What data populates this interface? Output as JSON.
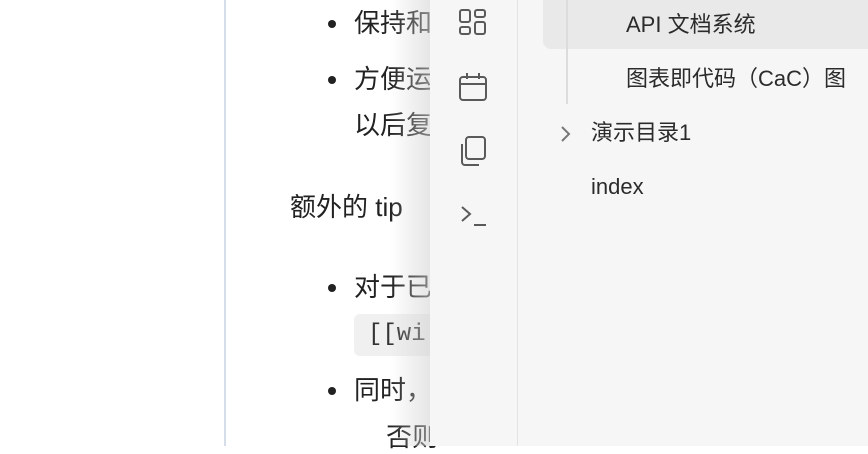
{
  "editor": {
    "bullet1": "保持和",
    "bullet2_line1": "方便运",
    "bullet2_line2": "以后复",
    "extra_tip": "额外的 tip",
    "bullet3": "对于已",
    "code_text": "[[wi",
    "bullet4": "同时，",
    "bullet4_line2": "否则"
  },
  "ribbon": {
    "icons": [
      "grid-icon",
      "calendar-icon",
      "copy-icon",
      "terminal-icon"
    ]
  },
  "sidebar": {
    "active_item": "API 文档系统",
    "item2": "图表即代码（CaC）图",
    "folder": "演示目录1",
    "file": "index"
  }
}
